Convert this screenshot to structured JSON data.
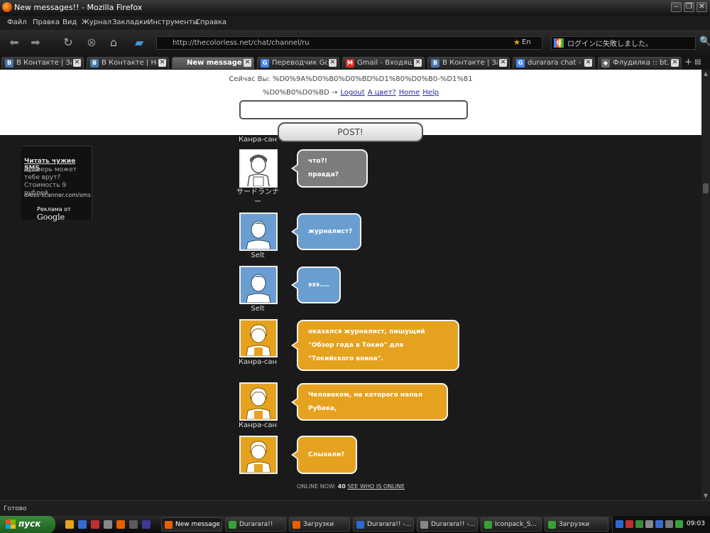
{
  "window": {
    "title": "New messages!! - Mozilla Firefox"
  },
  "menu": [
    "Файл",
    "Правка",
    "Вид",
    "Журнал",
    "Закладки",
    "Инструменты",
    "Справка"
  ],
  "nav": {
    "url": "http://thecolorless.net/chat/channel/ru",
    "lang": "En",
    "search_text": "ログインに失敗しました。"
  },
  "tabs": [
    {
      "label": "В Контакте | Закл...",
      "fav": "B",
      "color": "#4a76a8"
    },
    {
      "label": "В Контакте | Ново...",
      "fav": "B",
      "color": "#4a76a8"
    },
    {
      "label": "New messages!!",
      "fav": "",
      "color": ""
    },
    {
      "label": "Переводчик Google",
      "fav": "G",
      "color": "#4285f4"
    },
    {
      "label": "Gmail - Входящие (...",
      "fav": "M",
      "color": "#d93025"
    },
    {
      "label": "В Контакте | Закл...",
      "fav": "B",
      "color": "#4a76a8"
    },
    {
      "label": "durarara chat - Goo...",
      "fav": "G",
      "color": "#4285f4"
    },
    {
      "label": "Флудилка :: bt.bas...",
      "fav": "◆",
      "color": "#6a6a6a"
    }
  ],
  "header": {
    "status_prefix": "Сейчас Вы: %D0%9A%D0%B0%D0%BD%D1%80%D0%B0-%D1%81",
    "status_suffix": "%D0%B0%D0%BD →",
    "logout": "Logout",
    "color_link": "A цвет?",
    "home": "Home",
    "help": "Help",
    "post_label": "POST!"
  },
  "ad": {
    "title": "Читать чужие SMS",
    "body": "Проверь может тебе врут? Стоимость 9 рублей",
    "url": "dress-scanner.com/sms.h",
    "footer_prefix": "Реклама от",
    "footer_brand": "Google"
  },
  "messages": [
    {
      "user": "Канра-сан",
      "text": ""
    },
    {
      "user": "サードランナー",
      "text": "что?! правда?",
      "color": "grey"
    },
    {
      "user": "Selt",
      "text": "журналист?",
      "color": "blue"
    },
    {
      "user": "Selt",
      "text": "эээ....",
      "color": "blue"
    },
    {
      "user": "Канра-сан",
      "text": "оказался журналист, пишущий \"Обзор года в Токио\" для \"Токийского воина\".",
      "color": "orange"
    },
    {
      "user": "Канра-сан",
      "text": "Человеком, на которого напал Рубака,",
      "color": "orange"
    },
    {
      "user": "",
      "text": "Слыхали?",
      "color": "orange"
    }
  ],
  "online": {
    "label": "ONLINE NOW:",
    "count": "40",
    "link": "SEE WHO IS ONLINE"
  },
  "statusbar": {
    "text": "Готово"
  },
  "taskbar": {
    "start": "пуск",
    "tasks": [
      {
        "label": "New message...",
        "color": "#e66000"
      },
      {
        "label": "Durarara!!",
        "color": "#3aa03a"
      },
      {
        "label": "Загрузки",
        "color": "#e66000"
      },
      {
        "label": "Durarara!! -...",
        "color": "#2a6ad0"
      },
      {
        "label": "Durarara!! -...",
        "color": "#888888"
      },
      {
        "label": "Iconpack_S...",
        "color": "#3aa03a"
      },
      {
        "label": "Загрузки",
        "color": "#3aa03a"
      }
    ],
    "clock": "09:03"
  }
}
